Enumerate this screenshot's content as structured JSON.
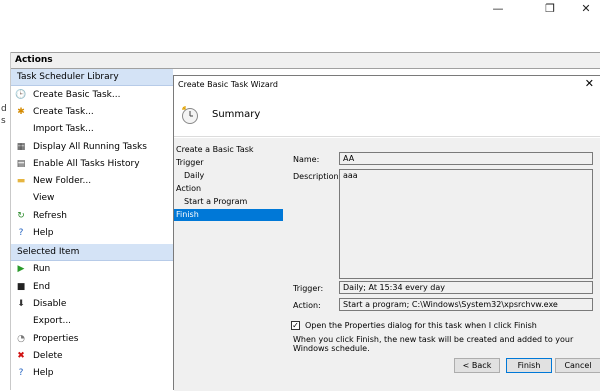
{
  "window": {
    "minimize": "—",
    "restore": "❐",
    "close": "✕"
  },
  "left_strip": {
    "chars": [
      "d",
      "s"
    ]
  },
  "actions": {
    "header": "Actions",
    "library_section": "Task Scheduler Library",
    "library_items": [
      {
        "label": "Create Basic Task...",
        "icon": "create-basic-task-icon"
      },
      {
        "label": "Create Task...",
        "icon": "create-task-icon"
      },
      {
        "label": "Import Task...",
        "icon": "import-icon"
      },
      {
        "label": "Display All Running Tasks",
        "icon": "running-tasks-icon"
      },
      {
        "label": "Enable All Tasks History",
        "icon": "history-icon"
      },
      {
        "label": "New Folder...",
        "icon": "folder-icon"
      },
      {
        "label": "View",
        "icon": "view-icon"
      },
      {
        "label": "Refresh",
        "icon": "refresh-icon"
      },
      {
        "label": "Help",
        "icon": "help-icon"
      }
    ],
    "selected_section": "Selected Item",
    "selected_items": [
      {
        "label": "Run",
        "icon": "run-icon"
      },
      {
        "label": "End",
        "icon": "end-icon"
      },
      {
        "label": "Disable",
        "icon": "disable-icon"
      },
      {
        "label": "Export...",
        "icon": "export-icon"
      },
      {
        "label": "Properties",
        "icon": "properties-icon"
      },
      {
        "label": "Delete",
        "icon": "delete-icon"
      },
      {
        "label": "Help",
        "icon": "help-icon"
      }
    ]
  },
  "wizard": {
    "title": "Create Basic Task Wizard",
    "close": "✕",
    "heading": "Summary",
    "steps": [
      {
        "label": "Create a Basic Task",
        "sub": false,
        "selected": false
      },
      {
        "label": "Trigger",
        "sub": false,
        "selected": false
      },
      {
        "label": "Daily",
        "sub": true,
        "selected": false
      },
      {
        "label": "Action",
        "sub": false,
        "selected": false
      },
      {
        "label": "Start a Program",
        "sub": true,
        "selected": false
      },
      {
        "label": "Finish",
        "sub": false,
        "selected": true
      }
    ],
    "name_label": "Name:",
    "name_value": "AA",
    "description_label": "Description:",
    "description_value": "aaa",
    "trigger_label": "Trigger:",
    "trigger_value": "Daily; At 15:34 every day",
    "action_label": "Action:",
    "action_value": "Start a program; C:\\Windows\\System32\\xpsrchvw.exe",
    "open_properties_checked": true,
    "open_properties_label": "Open the Properties dialog for this task when I click Finish",
    "finish_note": "When you click Finish, the new task will be created and added to your Windows schedule.",
    "back_button": "< Back",
    "finish_button": "Finish",
    "cancel_button": "Cancel"
  }
}
